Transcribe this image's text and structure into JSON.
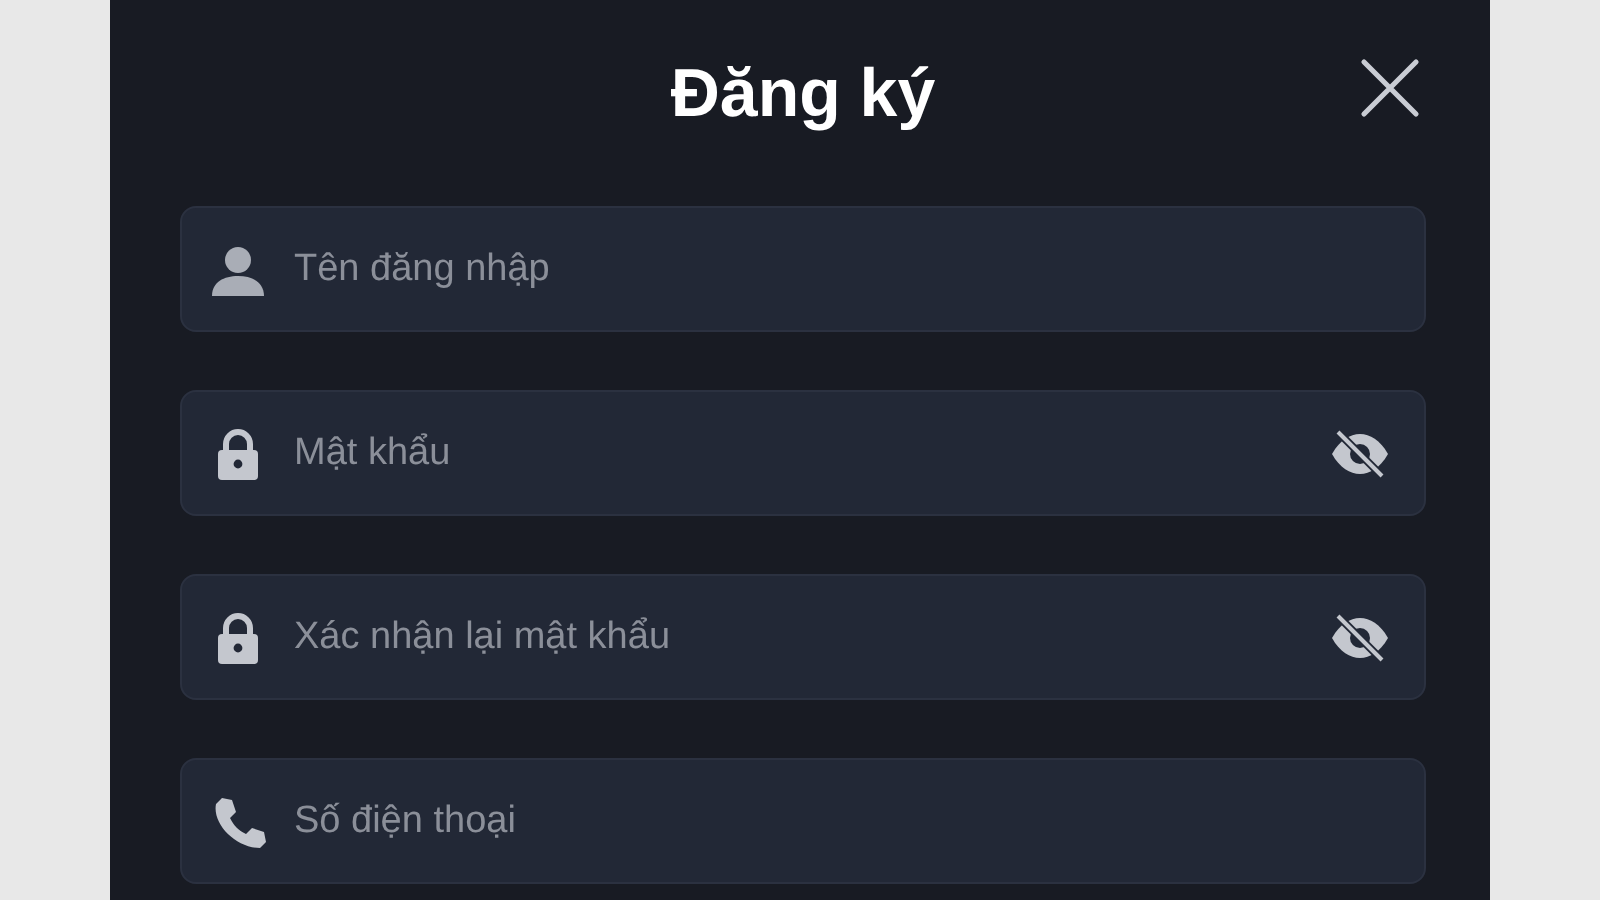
{
  "dialog": {
    "title": "Đăng ký"
  },
  "fields": [
    {
      "kind": "user",
      "placeholder": "Tên đăng nhập",
      "password_toggle": false
    },
    {
      "kind": "lock",
      "placeholder": "Mật khẩu",
      "password_toggle": true
    },
    {
      "kind": "lock",
      "placeholder": "Xác nhận lại mật khẩu",
      "password_toggle": true
    },
    {
      "kind": "phone",
      "placeholder": "Số điện thoại",
      "password_toggle": false
    }
  ]
}
